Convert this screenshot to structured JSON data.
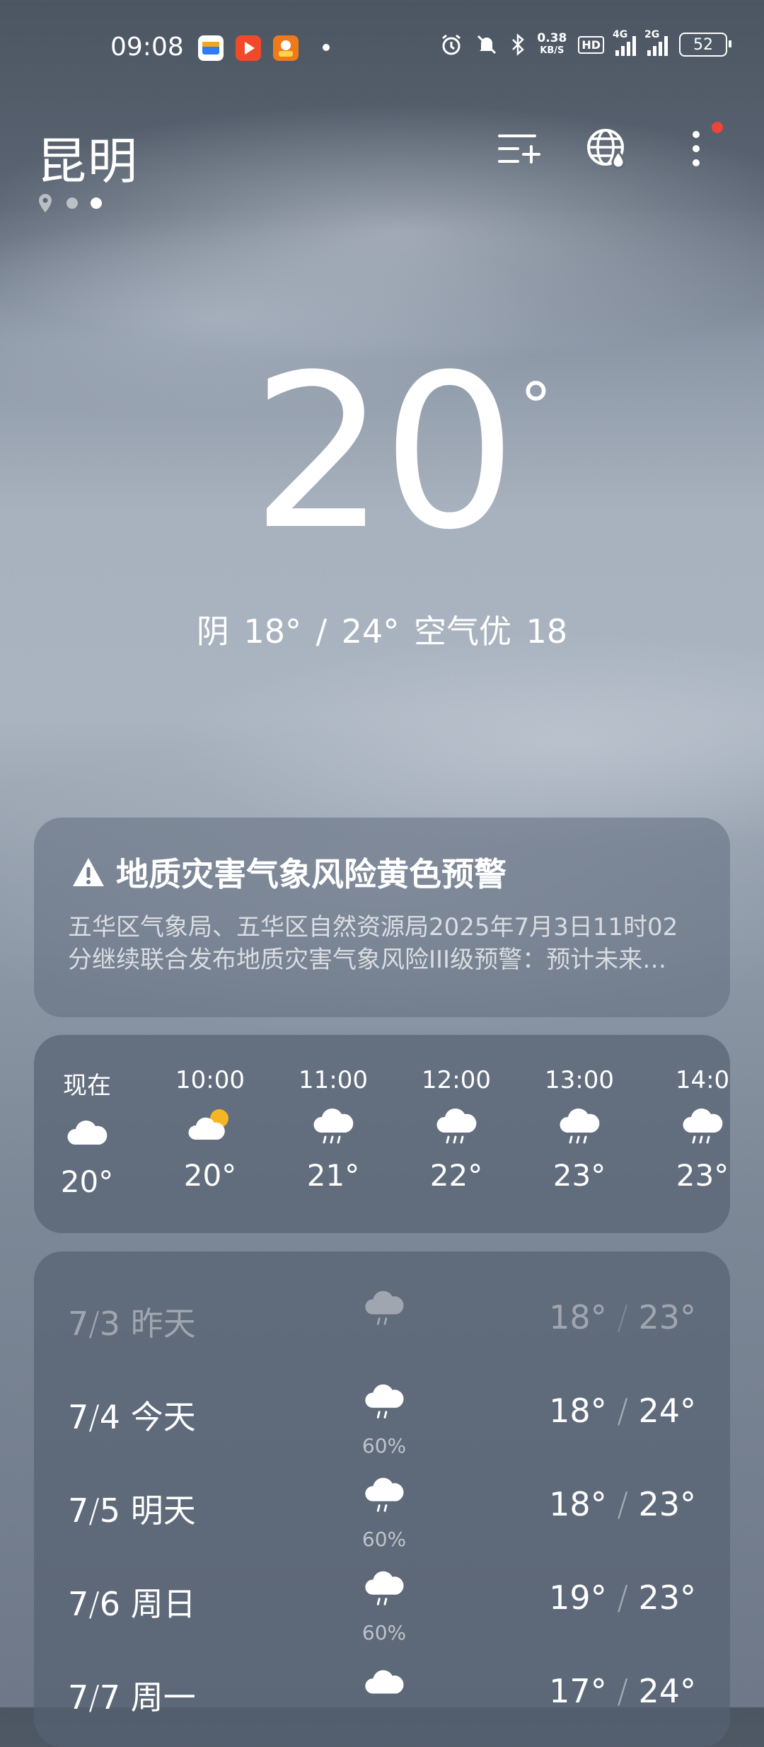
{
  "status_bar": {
    "time": "09:08",
    "net_speed_value": "0.38",
    "net_speed_unit": "KB/S",
    "hd_label": "HD",
    "signal1_label": "4G",
    "signal2_label": "2G",
    "battery": "52"
  },
  "header": {
    "city": "昆明",
    "icons": [
      "city-manage-icon",
      "globe-drop-icon",
      "more-vertical-icon"
    ]
  },
  "current": {
    "temp": "20",
    "degree": "°",
    "summary": "阴  18° / 24°  空气优 18"
  },
  "alert": {
    "title": "地质灾害气象风险黄色预警",
    "line1": "五华区气象局、五华区自然资源局2025年7月3日11时02",
    "line2": "分继续联合发布地质灾害气象风险III级预警：预计未来…"
  },
  "hourly": [
    {
      "time": "现在",
      "icon": "cloudy-icon",
      "temp": "20°"
    },
    {
      "time": "10:00",
      "icon": "partly-cloudy-icon",
      "temp": "20°"
    },
    {
      "time": "11:00",
      "icon": "light-rain-icon",
      "temp": "21°"
    },
    {
      "time": "12:00",
      "icon": "light-rain-icon",
      "temp": "22°"
    },
    {
      "time": "13:00",
      "icon": "light-rain-icon",
      "temp": "23°"
    },
    {
      "time": "14:0",
      "icon": "light-rain-icon",
      "temp": "23°"
    }
  ],
  "daily": [
    {
      "m": "7",
      "d": "3",
      "label": "昨天",
      "icon": "light-rain-icon",
      "pop": "",
      "low": "18°",
      "high": "23°"
    },
    {
      "m": "7",
      "d": "4",
      "label": "今天",
      "icon": "light-rain-icon",
      "pop": "60%",
      "low": "18°",
      "high": "24°"
    },
    {
      "m": "7",
      "d": "5",
      "label": "明天",
      "icon": "light-rain-icon",
      "pop": "60%",
      "low": "18°",
      "high": "23°"
    },
    {
      "m": "7",
      "d": "6",
      "label": "周日",
      "icon": "light-rain-icon",
      "pop": "60%",
      "low": "19°",
      "high": "23°"
    },
    {
      "m": "7",
      "d": "7",
      "label": "周一",
      "icon": "cloudy-icon",
      "pop": "",
      "low": "17°",
      "high": "24°"
    }
  ]
}
